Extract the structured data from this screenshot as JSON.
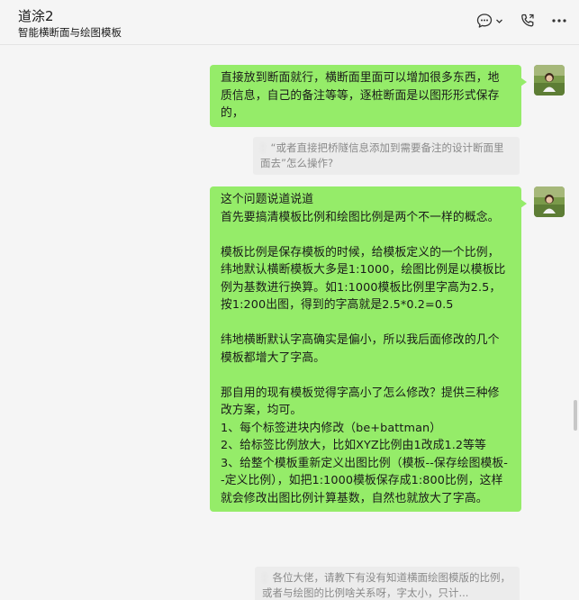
{
  "header": {
    "title": "道涂2",
    "subtitle": "智能横断面与绘图模板",
    "icons": [
      "chat-bubble-icon",
      "chevron-down-icon",
      "phone-icon",
      "more-icon"
    ]
  },
  "messages": [
    {
      "sender": "self",
      "text": "直接放到断面就行，横断面里面可以增加很多东西，地质信息，自己的备注等等，逐桩断面是以图形形式保存的，"
    },
    {
      "quote_name": "：",
      "quote_text": "“或者直接把桥隧信息添加到需要备注的设计断面里面去”怎么操作?"
    },
    {
      "sender": "self",
      "lines": [
        "这个问题说道说道",
        "首先要搞清模板比例和绘图比例是两个不一样的概念。",
        "",
        "模板比例是保存模板的时候，给模板定义的一个比例，纬地默认横断模板大多是1:1000，绘图比例是以模板比例为基数进行换算。如1:1000模板比例里字高为2.5，按1:200出图，得到的字高就是2.5*0.2=0.5",
        "",
        "纬地横断默认字高确实是偏小，所以我后面修改的几个模板都增大了字高。",
        "",
        "那自用的现有模板觉得字高小了怎么修改？提供三种修改方案，均可。",
        "1、每个标签进块内修改（be+battman）",
        "2、给标签比例放大，比如XYZ比例由1改成1.2等等",
        "3、给整个模板重新定义出图比例（模板--保存绘图模板--定义比例），如把1:1000模板保存成1:800比例，这样就会修改出图比例计算基数，自然也就放大了字高。"
      ]
    },
    {
      "quote_name": "：",
      "quote_text": "各位大佬，请教下有没有知道横面绘图模版的比例，或者与绘图的比例啥关系呀，字太小，只计..."
    }
  ],
  "colors": {
    "bubble_self": "#95ec69",
    "background": "#f5f5f5",
    "quote_bg": "#ececec"
  }
}
